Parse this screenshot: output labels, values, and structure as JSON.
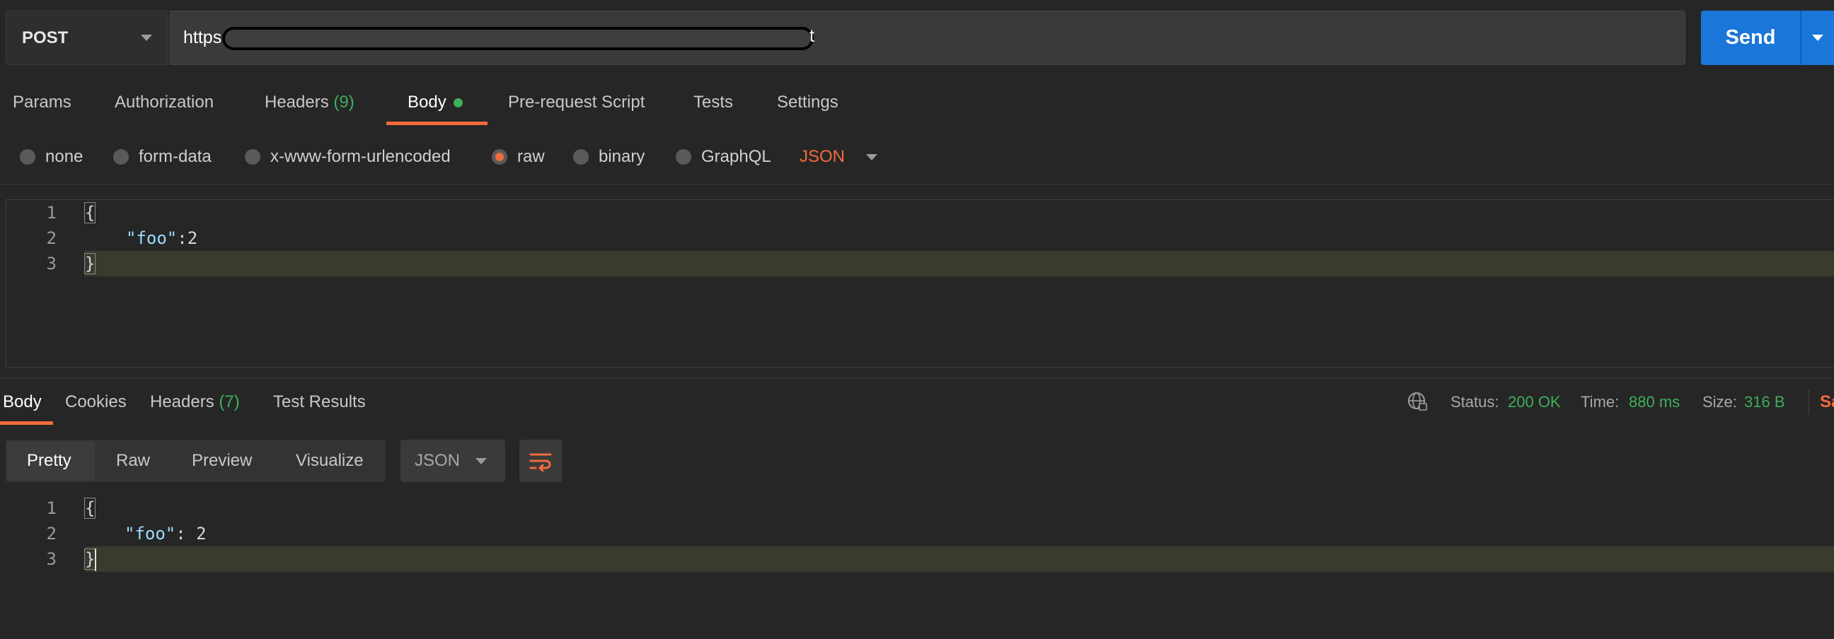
{
  "request": {
    "method": "POST",
    "url_visible_start": "https",
    "url_visible_end": "t",
    "send_label": "Send"
  },
  "request_tabs": [
    {
      "label": "Params"
    },
    {
      "label": "Authorization"
    },
    {
      "label": "Headers",
      "count": "(9)"
    },
    {
      "label": "Body"
    },
    {
      "label": "Pre-request Script"
    },
    {
      "label": "Tests"
    },
    {
      "label": "Settings"
    }
  ],
  "body_types": [
    "none",
    "form-data",
    "x-www-form-urlencoded",
    "raw",
    "binary",
    "GraphQL"
  ],
  "body_format": "JSON",
  "request_code": {
    "line_numbers": [
      "1",
      "2",
      "3"
    ],
    "line1": "{",
    "line2_key": "\"foo\"",
    "line2_rest": ":2",
    "line3": "}"
  },
  "response_tabs": [
    {
      "label": "Body"
    },
    {
      "label": "Cookies"
    },
    {
      "label": "Headers",
      "count": "(7)"
    },
    {
      "label": "Test Results"
    }
  ],
  "response_status": {
    "status_label": "Status:",
    "status_value": "200 OK",
    "time_label": "Time:",
    "time_value": "880 ms",
    "size_label": "Size:",
    "size_value": "316 B",
    "save_partial": "Sa"
  },
  "view_modes": [
    "Pretty",
    "Raw",
    "Preview",
    "Visualize"
  ],
  "response_format": "JSON",
  "response_code": {
    "line_numbers": [
      "1",
      "2",
      "3"
    ],
    "line1": "{",
    "line2_key": "\"foo\"",
    "line2_rest": ": 2",
    "line3": "}"
  },
  "colors": {
    "accent": "#f26b3a",
    "send_blue": "#1a76d8",
    "success_green": "#3fae5a",
    "background": "#262626"
  }
}
